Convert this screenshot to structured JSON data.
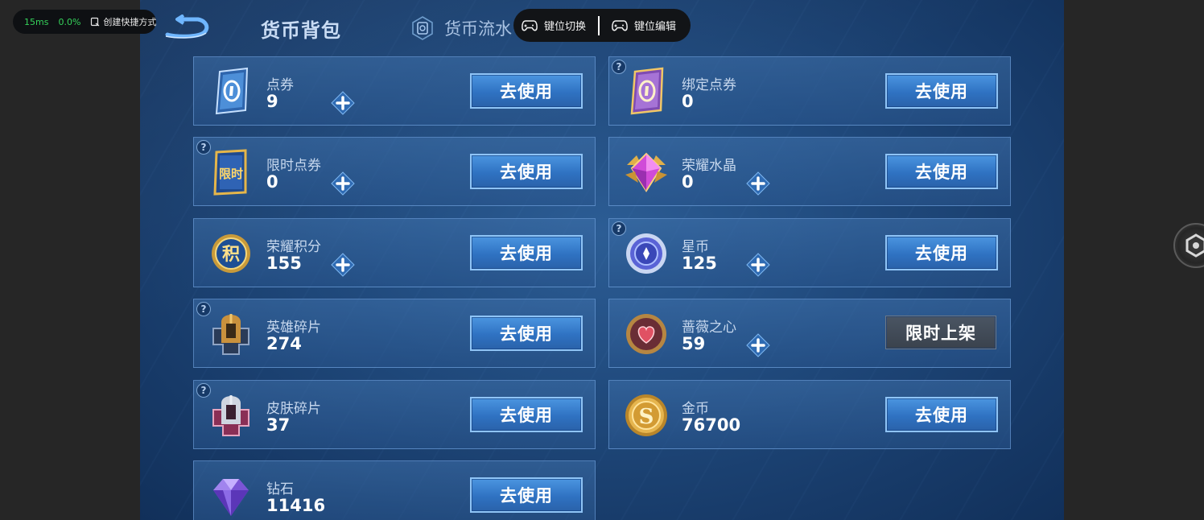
{
  "overlay": {
    "latency": "15ms",
    "loss": "0.0%",
    "shortcut_label": "创建快捷方式",
    "keymap_switch_label": "键位切换",
    "keymap_edit_label": "键位编辑"
  },
  "header": {
    "active_tab": "货币背包",
    "flow_tab": "货币流水"
  },
  "currencies": [
    {
      "name": "点券",
      "count": "9",
      "help": false,
      "plus": true,
      "button": "去使用",
      "button_style": "blue",
      "icon": "coupon-card-icon"
    },
    {
      "name": "绑定点券",
      "count": "0",
      "help": true,
      "plus": false,
      "button": "去使用",
      "button_style": "blue",
      "icon": "bound-coupon-card-icon"
    },
    {
      "name": "限时点券",
      "count": "0",
      "help": true,
      "plus": true,
      "button": "去使用",
      "button_style": "blue",
      "icon": "limited-coupon-icon",
      "icon_text": "限时"
    },
    {
      "name": "荣耀水晶",
      "count": "0",
      "help": false,
      "plus": true,
      "button": "去使用",
      "button_style": "blue",
      "icon": "glory-crystal-icon"
    },
    {
      "name": "荣耀积分",
      "count": "155",
      "help": false,
      "plus": true,
      "button": "去使用",
      "button_style": "blue",
      "icon": "glory-points-icon",
      "icon_text": "积"
    },
    {
      "name": "星币",
      "count": "125",
      "help": true,
      "plus": true,
      "button": "去使用",
      "button_style": "blue",
      "icon": "star-coin-icon"
    },
    {
      "name": "英雄碎片",
      "count": "274",
      "help": true,
      "plus": false,
      "button": "去使用",
      "button_style": "blue",
      "icon": "hero-fragment-icon"
    },
    {
      "name": "蔷薇之心",
      "count": "59",
      "help": false,
      "plus": true,
      "button": "限时上架",
      "button_style": "gray",
      "icon": "rose-heart-icon"
    },
    {
      "name": "皮肤碎片",
      "count": "37",
      "help": true,
      "plus": false,
      "button": "去使用",
      "button_style": "blue",
      "icon": "skin-fragment-icon"
    },
    {
      "name": "金币",
      "count": "76700",
      "help": false,
      "plus": false,
      "button": "去使用",
      "button_style": "blue",
      "icon": "gold-coin-icon",
      "icon_text": "S"
    },
    {
      "name": "钻石",
      "count": "11416",
      "help": false,
      "plus": false,
      "button": "去使用",
      "button_style": "blue",
      "icon": "diamond-icon"
    }
  ]
}
